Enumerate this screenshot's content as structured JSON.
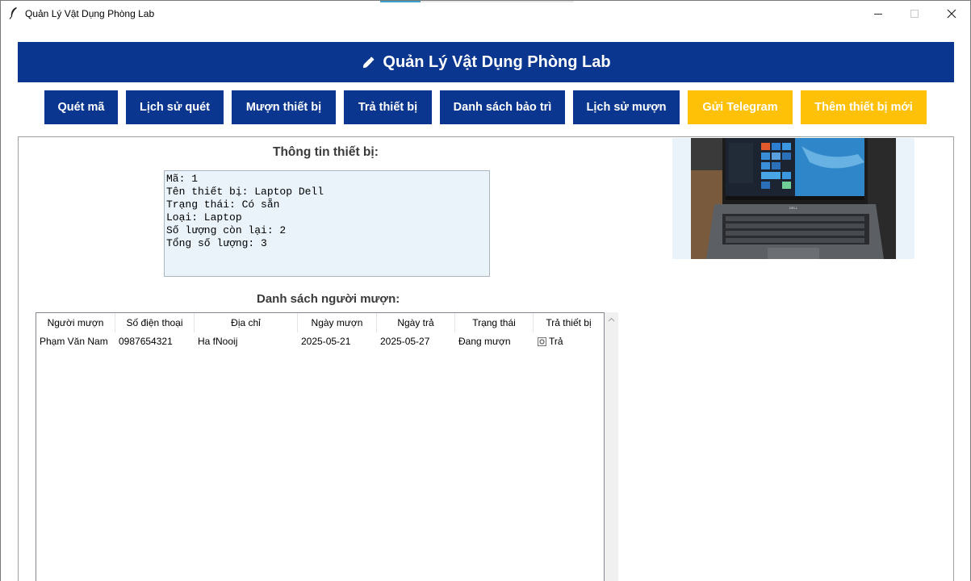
{
  "window": {
    "title": "Quản Lý Vật Dụng Phòng Lab",
    "controls": {
      "minimize": "minimize-icon",
      "maximize": "maximize-icon",
      "close": "close-icon"
    }
  },
  "header": {
    "icon": "pen-icon",
    "title": "Quản Lý Vật Dụng Phòng Lab",
    "color": "#0a3690"
  },
  "toolbar": {
    "buttons": [
      {
        "label": "Quét mã",
        "color": "#0a3690"
      },
      {
        "label": "Lịch sử quét",
        "color": "#0a3690"
      },
      {
        "label": "Mượn thiết bị",
        "color": "#0a3690"
      },
      {
        "label": "Trả thiết bị",
        "color": "#0a3690"
      },
      {
        "label": "Danh sách bảo trì",
        "color": "#0a3690"
      },
      {
        "label": "Lịch sử mượn",
        "color": "#0a3690"
      },
      {
        "label": "Gửi Telegram",
        "color": "#ffc107"
      },
      {
        "label": "Thêm thiết bị mới",
        "color": "#ffc107"
      }
    ]
  },
  "device_info": {
    "heading": "Thông tin thiết bị:",
    "lines": [
      "Mã: 1",
      "Tên thiết bị: Laptop Dell",
      "Trạng thái: Có sẵn",
      "Loại: Laptop",
      "Số lượng còn lại: 2",
      "Tổng số lượng: 3"
    ]
  },
  "device_image": {
    "icon": "laptop-photo"
  },
  "borrowers": {
    "heading": "Danh sách người mượn:",
    "columns": [
      "Người mượn",
      "Số điện thoại",
      "Địa chỉ",
      "Ngày mượn",
      "Ngày trả",
      "Trạng thái",
      "Trả thiết bị"
    ],
    "rows": [
      {
        "name": "Phạm Văn Nam",
        "phone": "0987654321",
        "address": "Ha fNooij",
        "borrow_date": "2025-05-21",
        "return_date": "2025-05-27",
        "status": "Đang mượn",
        "action_icon": "return-icon",
        "action": "Trả"
      }
    ]
  }
}
